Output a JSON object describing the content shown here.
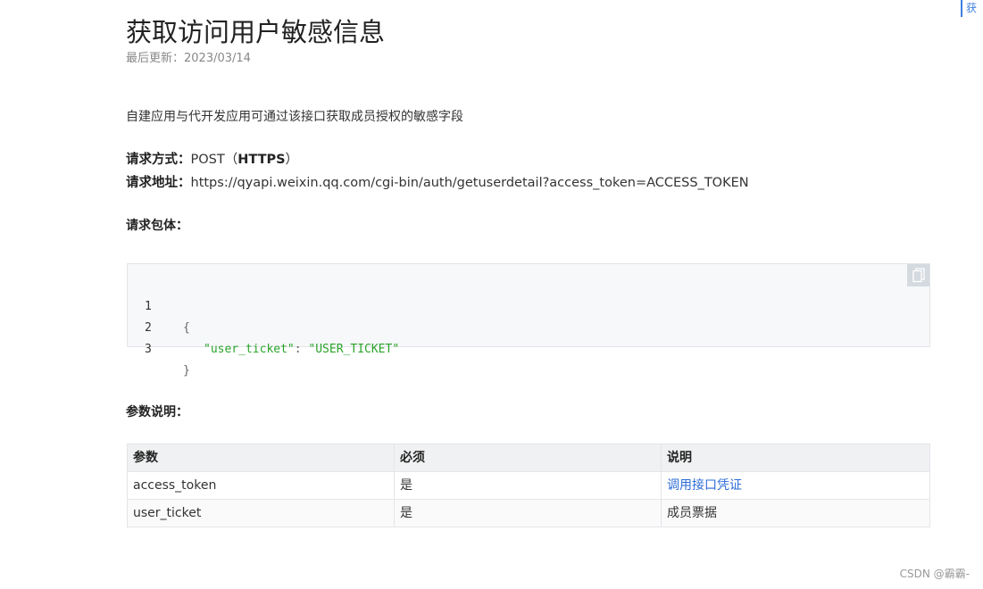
{
  "page": {
    "title": "获取访问用户敏感信息",
    "updated_label": "最后更新：",
    "updated_date": "2023/03/14",
    "description": "自建应用与代开发应用可通过该接口获取成员授权的敏感字段",
    "request_method_label": "请求方式：",
    "request_method_value": "POST（",
    "request_method_proto": "HTTPS",
    "request_method_close": "）",
    "request_url_label": "请求地址：",
    "request_url_value": "https://qyapi.weixin.qq.com/cgi-bin/auth/getuserdetail?access_token=ACCESS_TOKEN",
    "body_label": "请求包体：",
    "params_label": "参数说明："
  },
  "code": {
    "lines": [
      {
        "num": "1",
        "open": "{"
      },
      {
        "num": "2",
        "key": "\"user_ticket\"",
        "colon": ": ",
        "value": "\"USER_TICKET\""
      },
      {
        "num": "3",
        "close": "}"
      }
    ],
    "copy_icon": "copy-icon"
  },
  "params_table": {
    "headers": [
      "参数",
      "必须",
      "说明"
    ],
    "rows": [
      [
        "access_token",
        "是",
        "调用接口凭证"
      ],
      [
        "user_ticket",
        "是",
        "成员票据"
      ]
    ]
  },
  "side_tab": "获",
  "watermark": "CSDN @霸霸-",
  "colors": {
    "link": "#2b6bd6",
    "code_string": "#2aa32a",
    "accent": "#3d7fe0"
  }
}
